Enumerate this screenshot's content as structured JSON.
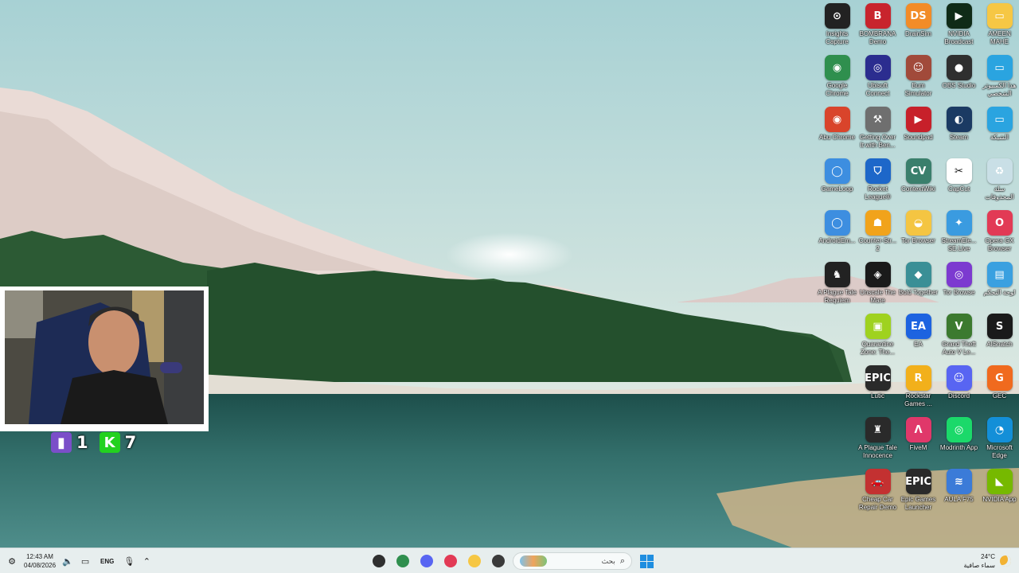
{
  "desktop_icons": [
    {
      "label": "Insights Capture",
      "glyph": "⊙",
      "bg": "#222222"
    },
    {
      "label": "BOMBRANA Demo",
      "glyph": "B",
      "bg": "#c8242d"
    },
    {
      "label": "DrainSim",
      "glyph": "DS",
      "bg": "#f28c28"
    },
    {
      "label": "NVIDIA Broadcast",
      "glyph": "▶",
      "bg": "#0f2b17"
    },
    {
      "label": "AMEEN MAHE",
      "glyph": "▭",
      "bg": "#f6c744"
    },
    {
      "label": "Google Chrome",
      "glyph": "◉",
      "bg": "#2f8f4e"
    },
    {
      "label": "Ubisoft Connect",
      "glyph": "◎",
      "bg": "#2b2d8f"
    },
    {
      "label": "Bum Simulator",
      "glyph": "☺",
      "bg": "#a14a3a"
    },
    {
      "label": "OBS Studio",
      "glyph": "●",
      "bg": "#2f2f2f"
    },
    {
      "label": "هذا الكمبيوتر الشخصي",
      "glyph": "▭",
      "bg": "#2aa4e0"
    },
    {
      "label": "Abu Chrome",
      "glyph": "◉",
      "bg": "#d9442b"
    },
    {
      "label": "Getting Over It with Ben...",
      "glyph": "⚒",
      "bg": "#6f6f6f"
    },
    {
      "label": "Soundpad",
      "glyph": "▶",
      "bg": "#c7202a"
    },
    {
      "label": "Steam",
      "glyph": "◐",
      "bg": "#1b3a63"
    },
    {
      "label": "الشبكة",
      "glyph": "▭",
      "bg": "#2aa4e0"
    },
    {
      "label": "GameLoop",
      "glyph": "◯",
      "bg": "#3d8ee0"
    },
    {
      "label": "Rocket League®",
      "glyph": "⛉",
      "bg": "#1d67c9"
    },
    {
      "label": "ContextWiki",
      "glyph": "CV",
      "bg": "#3a7f6c"
    },
    {
      "label": "CapCut",
      "glyph": "✂",
      "bg": "#ffffff"
    },
    {
      "label": "سلة المحذوفات",
      "glyph": "♻",
      "bg": "#c9dfe6"
    },
    {
      "label": "AndroidEm...",
      "glyph": "◯",
      "bg": "#3d8ee0"
    },
    {
      "label": "Counter-Str... 2",
      "glyph": "☗",
      "bg": "#f1a31b"
    },
    {
      "label": "Tor Browser",
      "glyph": "◒",
      "bg": "#f4c542"
    },
    {
      "label": "StreamEle... SE.Live",
      "glyph": "✦",
      "bg": "#3a9be0"
    },
    {
      "label": "Opera GX Browser",
      "glyph": "O",
      "bg": "#e23a55"
    },
    {
      "label": "A Plague Tale Requiem",
      "glyph": "♞",
      "bg": "#222222"
    },
    {
      "label": "Unscale The Mare",
      "glyph": "◈",
      "bg": "#1a1a1a"
    },
    {
      "label": "Bold Together",
      "glyph": "◆",
      "bg": "#3a8f96"
    },
    {
      "label": "Tor Browse",
      "glyph": "◎",
      "bg": "#7c3ad0"
    },
    {
      "label": "لوحة التحكم",
      "glyph": "▤",
      "bg": "#3aa0e0"
    },
    {
      "label": "",
      "glyph": "",
      "bg": "transparent"
    },
    {
      "label": "Quarantine Zone: The...",
      "glyph": "▣",
      "bg": "#9fd21f"
    },
    {
      "label": "EA",
      "glyph": "EA",
      "bg": "#1d63e0"
    },
    {
      "label": "Grand Theft Auto V Le...",
      "glyph": "V",
      "bg": "#3c7a2f"
    },
    {
      "label": "AISnatch",
      "glyph": "S",
      "bg": "#1a1a1a"
    },
    {
      "label": "",
      "glyph": "",
      "bg": "transparent"
    },
    {
      "label": "Lutic",
      "glyph": "EPIC",
      "bg": "#2a2a2a"
    },
    {
      "label": "Rockstar Games ...",
      "glyph": "R",
      "bg": "#f2b01b"
    },
    {
      "label": "Discord",
      "glyph": "☺",
      "bg": "#5865f2"
    },
    {
      "label": "GEC",
      "glyph": "G",
      "bg": "#f06a1e"
    },
    {
      "label": "",
      "glyph": "",
      "bg": "transparent"
    },
    {
      "label": "A Plague Tale Innocence",
      "glyph": "♜",
      "bg": "#2a2a2a"
    },
    {
      "label": "FiveM",
      "glyph": "Λ",
      "bg": "#e0386a"
    },
    {
      "label": "Modrinth App",
      "glyph": "◎",
      "bg": "#1bd96a"
    },
    {
      "label": "Microsoft Edge",
      "glyph": "◔",
      "bg": "#138fd8"
    },
    {
      "label": "",
      "glyph": "",
      "bg": "transparent"
    },
    {
      "label": "Cheap Car Repair Demo",
      "glyph": "🚗",
      "bg": "#c33131"
    },
    {
      "label": "Epic Games Launcher",
      "glyph": "EPIC",
      "bg": "#2a2a2a"
    },
    {
      "label": "AULA F75",
      "glyph": "≋",
      "bg": "#3b7bd8"
    },
    {
      "label": "NVIDIA App",
      "glyph": "◣",
      "bg": "#76b900"
    }
  ],
  "viewer_counts": {
    "twitch": {
      "value": "1",
      "color": "#7b4fc9",
      "icon": "twitch-icon"
    },
    "kick": {
      "value": "7",
      "color": "#22d11f",
      "icon": "kick-icon"
    }
  },
  "taskbar": {
    "time": "12:43 AM",
    "date": "04/08/2026",
    "language": "ENG",
    "search_placeholder": "بحث",
    "weather_temp": "24°C",
    "weather_desc": "سماء صافية",
    "pinned_apps": [
      {
        "name": "obs-app",
        "color": "#2f2f2f"
      },
      {
        "name": "chrome-app",
        "color": "#2f8f4e"
      },
      {
        "name": "discord-app",
        "color": "#5865f2"
      },
      {
        "name": "opera-gx-app",
        "color": "#e23a55"
      },
      {
        "name": "file-explorer-app",
        "color": "#f6c744"
      },
      {
        "name": "terminal-app",
        "color": "#3a3a3a"
      }
    ]
  }
}
